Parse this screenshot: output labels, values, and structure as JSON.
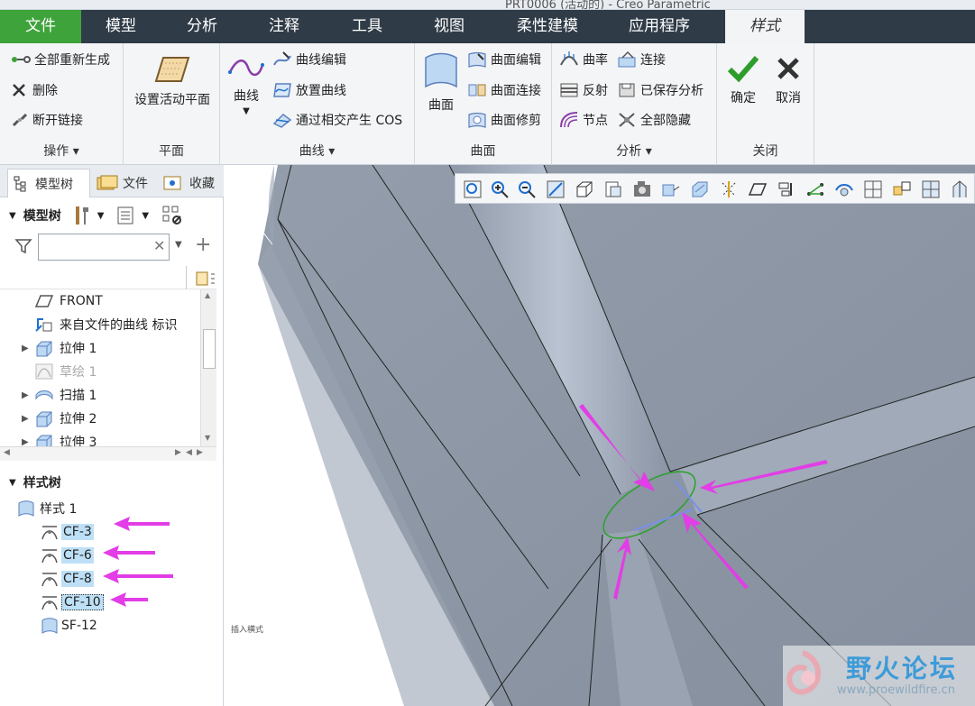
{
  "window": {
    "title_fragment": "PRT0006 (活动的) - Creo Parametric"
  },
  "menu": {
    "tabs": [
      "文件",
      "模型",
      "分析",
      "注释",
      "工具",
      "视图",
      "柔性建模",
      "应用程序",
      "样式"
    ],
    "active": "样式"
  },
  "ribbon": {
    "ops": {
      "regenerate": "全部重新生成",
      "delete": "删除",
      "break_link": "断开链接",
      "label": "操作"
    },
    "plane": {
      "set_active": "设置活动平面",
      "label": "平面"
    },
    "curves": {
      "curve": "曲线",
      "edit": "曲线编辑",
      "place": "放置曲线",
      "cos": "通过相交产生 COS",
      "label": "曲线"
    },
    "surfaces": {
      "surface": "曲面",
      "edit": "曲面编辑",
      "connect": "曲面连接",
      "trim": "曲面修剪",
      "label": "曲面"
    },
    "analysis": {
      "curvature": "曲率",
      "connect": "连接",
      "reflect": "反射",
      "saved": "已保存分析",
      "node": "节点",
      "hide_all": "全部隐藏",
      "label": "分析"
    },
    "close": {
      "ok": "确定",
      "cancel": "取消",
      "label": "关闭"
    }
  },
  "left_panel": {
    "tabs": [
      "模型树",
      "文件",
      "收藏"
    ],
    "tree_title": "模型树",
    "filter_placeholder": "",
    "model_tree": [
      "FRONT",
      "来自文件的曲线 标识",
      "拉伸 1",
      "草绘 1",
      "扫描 1",
      "拉伸 2",
      "拉伸 3"
    ],
    "style_tree_title": "样式树",
    "style_root": "样式 1",
    "style_items": [
      "CF-3",
      "CF-6",
      "CF-8",
      "CF-10",
      "SF-12"
    ]
  },
  "viewport": {
    "status_hint": "插入横式"
  },
  "watermark": {
    "name": "野火论坛",
    "url": "www.proewildfire.cn"
  },
  "colors": {
    "file_tab": "#3fa33b",
    "menubar": "#2f3b47",
    "ribbon_bg": "#f3f5f7",
    "viewport": "#8f99a8",
    "arrow": "#e23de6",
    "selection": "#bde0f7"
  }
}
